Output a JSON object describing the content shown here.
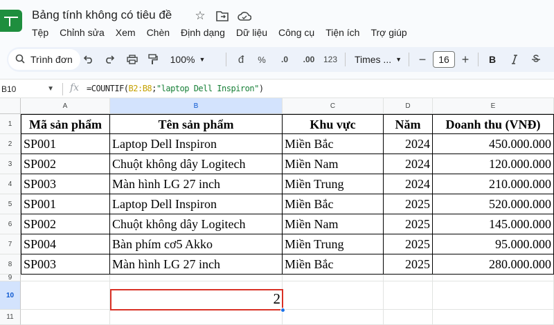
{
  "app": {
    "doc_title": "Bảng tính không có tiêu đề",
    "title_icons": [
      "star-icon",
      "move-folder-icon",
      "cloud-status-icon"
    ],
    "menu": [
      "Tệp",
      "Chỉnh sửa",
      "Xem",
      "Chèn",
      "Định dạng",
      "Dữ liệu",
      "Công cụ",
      "Tiện ích",
      "Trợ giúp"
    ]
  },
  "toolbar": {
    "search_label": "Trình đơn",
    "zoom": "100%",
    "currency": "đ",
    "percent": "%",
    "dec_decrease": ".0",
    "dec_increase": ".00",
    "number_format": "123",
    "font": "Times ...",
    "font_size": "16",
    "font_size_minus": "−",
    "font_size_plus": "+",
    "bold": "B"
  },
  "formula_bar": {
    "name_box": "B10",
    "fx": "fx",
    "formula_prefix": "=COUNTIF(",
    "formula_ref": "B2:B8",
    "formula_sep": ";",
    "formula_str": "\"laptop Dell Inspiron\"",
    "formula_suffix": ")"
  },
  "grid": {
    "columns": [
      "A",
      "B",
      "C",
      "D",
      "E"
    ],
    "rows": [
      "1",
      "2",
      "3",
      "4",
      "5",
      "6",
      "7",
      "8",
      "9",
      "10",
      "11"
    ],
    "headers": [
      "Mã sản phẩm",
      "Tên sản phẩm",
      "Khu vực",
      "Năm",
      "Doanh thu (VNĐ)"
    ],
    "data": [
      [
        "SP001",
        "Laptop Dell Inspiron",
        "Miền Bắc",
        "2024",
        "450.000.000"
      ],
      [
        "SP002",
        "Chuột không dây Logitech",
        "Miền Nam",
        "2024",
        "120.000.000"
      ],
      [
        "SP003",
        "Màn hình LG 27 inch",
        "Miền Trung",
        "2024",
        "210.000.000"
      ],
      [
        "SP001",
        "Laptop Dell Inspiron",
        "Miền Bắc",
        "2025",
        "520.000.000"
      ],
      [
        "SP002",
        "Chuột không dây Logitech",
        "Miền Nam",
        "2025",
        "145.000.000"
      ],
      [
        "SP004",
        "Bàn phím cơ5 Akko",
        "Miền Trung",
        "2025",
        "95.000.000"
      ],
      [
        "SP003",
        "Màn hình LG 27 inch",
        "Miền Bắc",
        "2025",
        "280.000.000"
      ]
    ],
    "result_cell": "2",
    "selected_column": "B",
    "selected_row": "10"
  }
}
